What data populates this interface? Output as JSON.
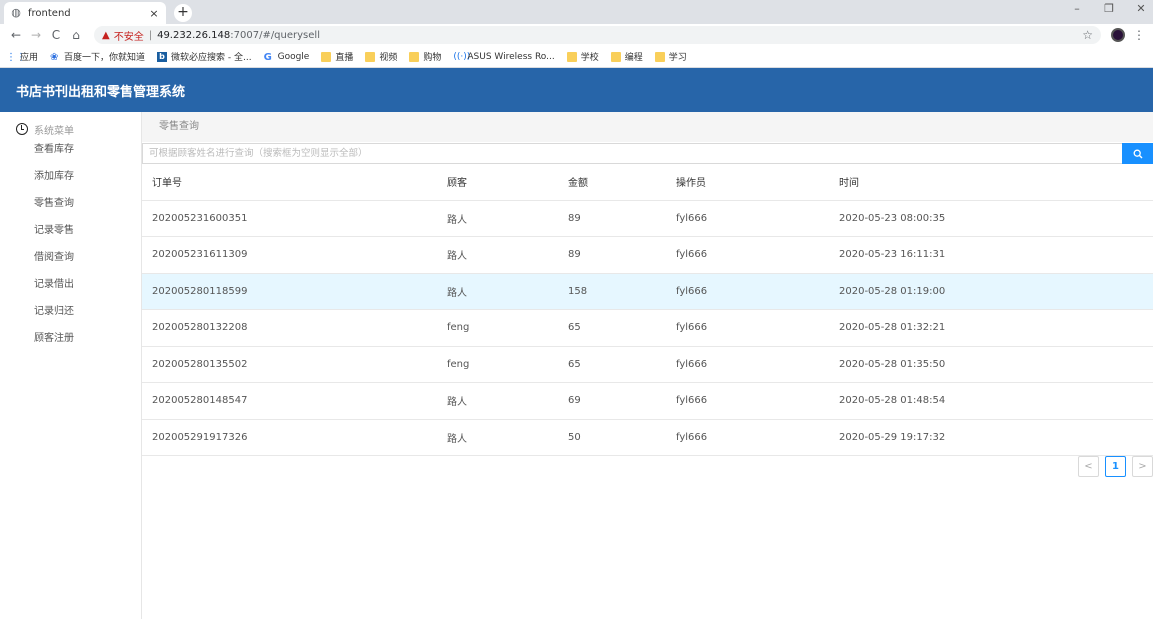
{
  "browser": {
    "tab_title": "frontend",
    "tab_close": "×",
    "new_tab": "+",
    "win_minimize": "–",
    "win_restore": "❐",
    "win_close": "✕",
    "back": "←",
    "forward": "→",
    "reload": "C",
    "home": "⌂",
    "url_warning": "▲",
    "url_insecure": "不安全",
    "url_sep": "|",
    "url_host": "49.232.26.148",
    "url_path": ":7007/#/querysell",
    "star": "☆",
    "menu": "⋮"
  },
  "bookmarks": [
    {
      "label": "应用",
      "icon": "apps-grid"
    },
    {
      "label": "百度一下，你就知道",
      "icon": "baidu-paw"
    },
    {
      "label": "微软必应搜索 - 全...",
      "icon": "bing-b"
    },
    {
      "label": "Google",
      "icon": "google-g"
    },
    {
      "label": "直播",
      "icon": "folder"
    },
    {
      "label": "视频",
      "icon": "folder"
    },
    {
      "label": "购物",
      "icon": "folder"
    },
    {
      "label": "ASUS Wireless Ro...",
      "icon": "wifi"
    },
    {
      "label": "学校",
      "icon": "folder"
    },
    {
      "label": "编程",
      "icon": "folder"
    },
    {
      "label": "学习",
      "icon": "folder"
    }
  ],
  "app": {
    "title": "书店书刊出租和零售管理系统",
    "accent": "#2765a9"
  },
  "sidebar": {
    "title": "系统菜单",
    "items": [
      "查看库存",
      "添加库存",
      "零售查询",
      "记录零售",
      "借阅查询",
      "记录借出",
      "记录归还",
      "顾客注册"
    ]
  },
  "main": {
    "breadcrumb": "零售查询",
    "search_placeholder": "可根据顾客姓名进行查询（搜索框为空则显示全部）",
    "columns": [
      "订单号",
      "顾客",
      "金额",
      "操作员",
      "时间"
    ],
    "rows": [
      [
        "202005231600351",
        "路人",
        "89",
        "fyl666",
        "2020-05-23 08:00:35"
      ],
      [
        "202005231611309",
        "路人",
        "89",
        "fyl666",
        "2020-05-23 16:11:31"
      ],
      [
        "202005280118599",
        "路人",
        "158",
        "fyl666",
        "2020-05-28 01:19:00"
      ],
      [
        "202005280132208",
        "feng",
        "65",
        "fyl666",
        "2020-05-28 01:32:21"
      ],
      [
        "202005280135502",
        "feng",
        "65",
        "fyl666",
        "2020-05-28 01:35:50"
      ],
      [
        "202005280148547",
        "路人",
        "69",
        "fyl666",
        "2020-05-28 01:48:54"
      ],
      [
        "202005291917326",
        "路人",
        "50",
        "fyl666",
        "2020-05-29 19:17:32"
      ]
    ],
    "highlighted_row": 2,
    "pagination": {
      "prev": "<",
      "current": "1",
      "next": ">"
    }
  }
}
